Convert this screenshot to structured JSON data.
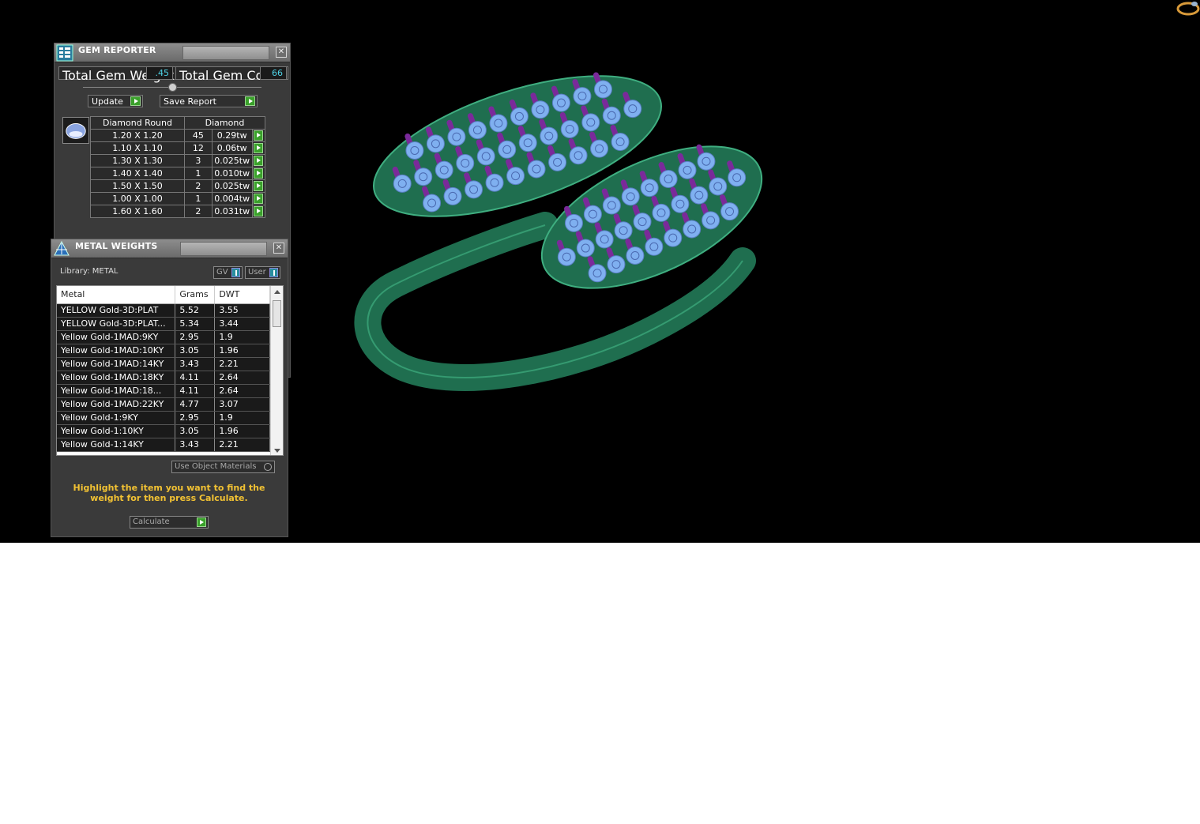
{
  "gem_reporter": {
    "title": "GEM REPORTER",
    "close": "✕",
    "total_weight_label": "Total Gem Weight",
    "total_weight_value": ".45",
    "total_count_label": "Total Gem Count",
    "total_count_value": "66",
    "update_label": "Update",
    "save_report_label": "Save Report",
    "table_headers": [
      "Diamond Round",
      "Diamond"
    ],
    "rows": [
      {
        "size": "1.20 X 1.20",
        "count": "45",
        "weight": "0.29tw"
      },
      {
        "size": "1.10 X 1.10",
        "count": "12",
        "weight": "0.06tw"
      },
      {
        "size": "1.30 X 1.30",
        "count": "3",
        "weight": "0.025tw"
      },
      {
        "size": "1.40 X 1.40",
        "count": "1",
        "weight": "0.010tw"
      },
      {
        "size": "1.50 X 1.50",
        "count": "2",
        "weight": "0.025tw"
      },
      {
        "size": "1.00 X 1.00",
        "count": "1",
        "weight": "0.004tw"
      },
      {
        "size": "1.60 X 1.60",
        "count": "2",
        "weight": "0.031tw"
      }
    ]
  },
  "metal_weights": {
    "title": "METAL WEIGHTS",
    "close": "✕",
    "library_label": "Library: METAL",
    "gv_label": "GV",
    "user_label": "User",
    "columns": [
      "Metal",
      "Grams",
      "DWT"
    ],
    "rows": [
      {
        "metal": "YELLOW Gold-3D:PLAT",
        "grams": "5.52",
        "dwt": "3.55"
      },
      {
        "metal": "YELLOW Gold-3D:PLAT...",
        "grams": "5.34",
        "dwt": "3.44"
      },
      {
        "metal": "Yellow Gold-1MAD:9KY",
        "grams": "2.95",
        "dwt": "1.9"
      },
      {
        "metal": "Yellow Gold-1MAD:10KY",
        "grams": "3.05",
        "dwt": "1.96"
      },
      {
        "metal": "Yellow Gold-1MAD:14KY",
        "grams": "3.43",
        "dwt": "2.21"
      },
      {
        "metal": "Yellow Gold-1MAD:18KY",
        "grams": "4.11",
        "dwt": "2.64"
      },
      {
        "metal": "Yellow Gold-1MAD:18...",
        "grams": "4.11",
        "dwt": "2.64"
      },
      {
        "metal": "Yellow Gold-1MAD:22KY",
        "grams": "4.77",
        "dwt": "3.07"
      },
      {
        "metal": "Yellow Gold-1:9KY",
        "grams": "2.95",
        "dwt": "1.9"
      },
      {
        "metal": "Yellow Gold-1:10KY",
        "grams": "3.05",
        "dwt": "1.96"
      },
      {
        "metal": "Yellow Gold-1:14KY",
        "grams": "3.43",
        "dwt": "2.21"
      }
    ],
    "use_object_materials_label": "Use Object Materials",
    "hint": "Highlight the item you want to find the weight for then press Calculate.",
    "calculate_label": "Calculate"
  },
  "colors": {
    "ring_metal": "#1f6e4f",
    "gem": "#7fb0f0",
    "prong": "#7a2a9a",
    "accent_value": "#4fd3e6",
    "go_button": "#3aa12b",
    "hint_text": "#f2c233"
  },
  "icons": {
    "gem_app_icon": "gem-reporter-icon",
    "metal_app_icon": "scale-icon",
    "corner": "ring-thumbnail-icon"
  }
}
